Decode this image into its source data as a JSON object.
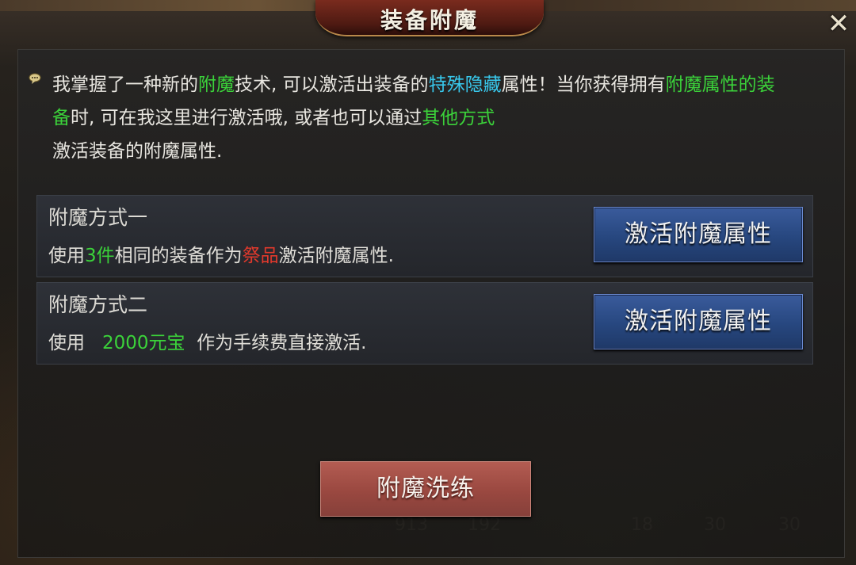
{
  "dialog": {
    "title": "装备附魔",
    "close_symbol": "✕"
  },
  "intro": {
    "parts": [
      {
        "text": "我掌握了一种新的",
        "color": "normal"
      },
      {
        "text": "附魔",
        "color": "green"
      },
      {
        "text": "技术, 可以激活出装备的",
        "color": "normal"
      },
      {
        "text": "特殊隐藏",
        "color": "cyan"
      },
      {
        "text": "属性！当你获得拥有",
        "color": "normal"
      },
      {
        "text": "附魔属性的装备",
        "color": "green"
      },
      {
        "text": "时, 可在我这里进行激活哦, 或者也可以通过",
        "color": "normal"
      },
      {
        "text": "其他方式",
        "color": "green"
      },
      {
        "text": "激活装备的附魔属性.",
        "color": "normal"
      }
    ]
  },
  "methods": [
    {
      "title": "附魔方式一",
      "desc": [
        {
          "text": "使用",
          "color": "normal"
        },
        {
          "text": "3件",
          "color": "green"
        },
        {
          "text": "相同的装备作为",
          "color": "normal"
        },
        {
          "text": "祭品",
          "color": "red"
        },
        {
          "text": "激活附魔属性.",
          "color": "normal"
        }
      ],
      "button_label": "激活附魔属性"
    },
    {
      "title": "附魔方式二",
      "desc": [
        {
          "text": "使用   ",
          "color": "normal"
        },
        {
          "text": "2000元宝",
          "color": "green"
        },
        {
          "text": "  作为手续费直接激活.",
          "color": "normal"
        }
      ],
      "button_label": "激活附魔属性"
    }
  ],
  "footer": {
    "reset_button_label": "附魔洗练"
  },
  "background_numbers": [
    "913",
    "192",
    "18",
    "30",
    "30"
  ],
  "colors": {
    "green": "#3bd23a",
    "cyan": "#38c8ec",
    "red": "#e0392c",
    "button_blue": "#27477f",
    "button_red": "#9a4840"
  },
  "icons": {
    "close": "close-icon",
    "speech": "speech-bubble-icon"
  }
}
